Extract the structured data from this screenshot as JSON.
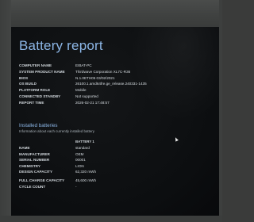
{
  "report": {
    "title": "Battery report"
  },
  "system_info": [
    {
      "label": "COMPUTER NAME",
      "value": "EIBAT-PC"
    },
    {
      "label": "SYSTEM PRODUCT NAME",
      "value": "Thirdwave Corporation XL7C-R36"
    },
    {
      "label": "BIOS",
      "value": "N.1.0ETH05 03/02/2021"
    },
    {
      "label": "OS BUILD",
      "value": "26100.1.amd64fre.ge_release.240331-1435"
    },
    {
      "label": "PLATFORM ROLE",
      "value": "Mobile"
    },
    {
      "label": "CONNECTED STANDBY",
      "value": "Not supported"
    },
    {
      "label": "REPORT TIME",
      "value": "2026-02-21   17:48:57"
    }
  ],
  "installed_batteries": {
    "title": "Installed batteries",
    "subtitle": "Information about each currently installed battery",
    "column_header": "BATTERY 1",
    "rows": [
      {
        "label": "NAME",
        "value": "standard"
      },
      {
        "label": "MANUFACTURER",
        "value": "OEM"
      },
      {
        "label": "SERIAL NUMBER",
        "value": "00001"
      },
      {
        "label": "CHEMISTRY",
        "value": "LION"
      },
      {
        "label": "DESIGN CAPACITY",
        "value": "62,320 mWh"
      }
    ],
    "rows2": [
      {
        "label": "FULL CHARGE CAPACITY",
        "value": "45,600 mWh"
      },
      {
        "label": "CYCLE COUNT",
        "value": "-"
      }
    ]
  },
  "colors": {
    "heading": "#8cb6e6",
    "screen_background": "#0c0e10",
    "bezel": "#3f4140"
  },
  "icons": {
    "cursor": "mouse-pointer-icon"
  }
}
